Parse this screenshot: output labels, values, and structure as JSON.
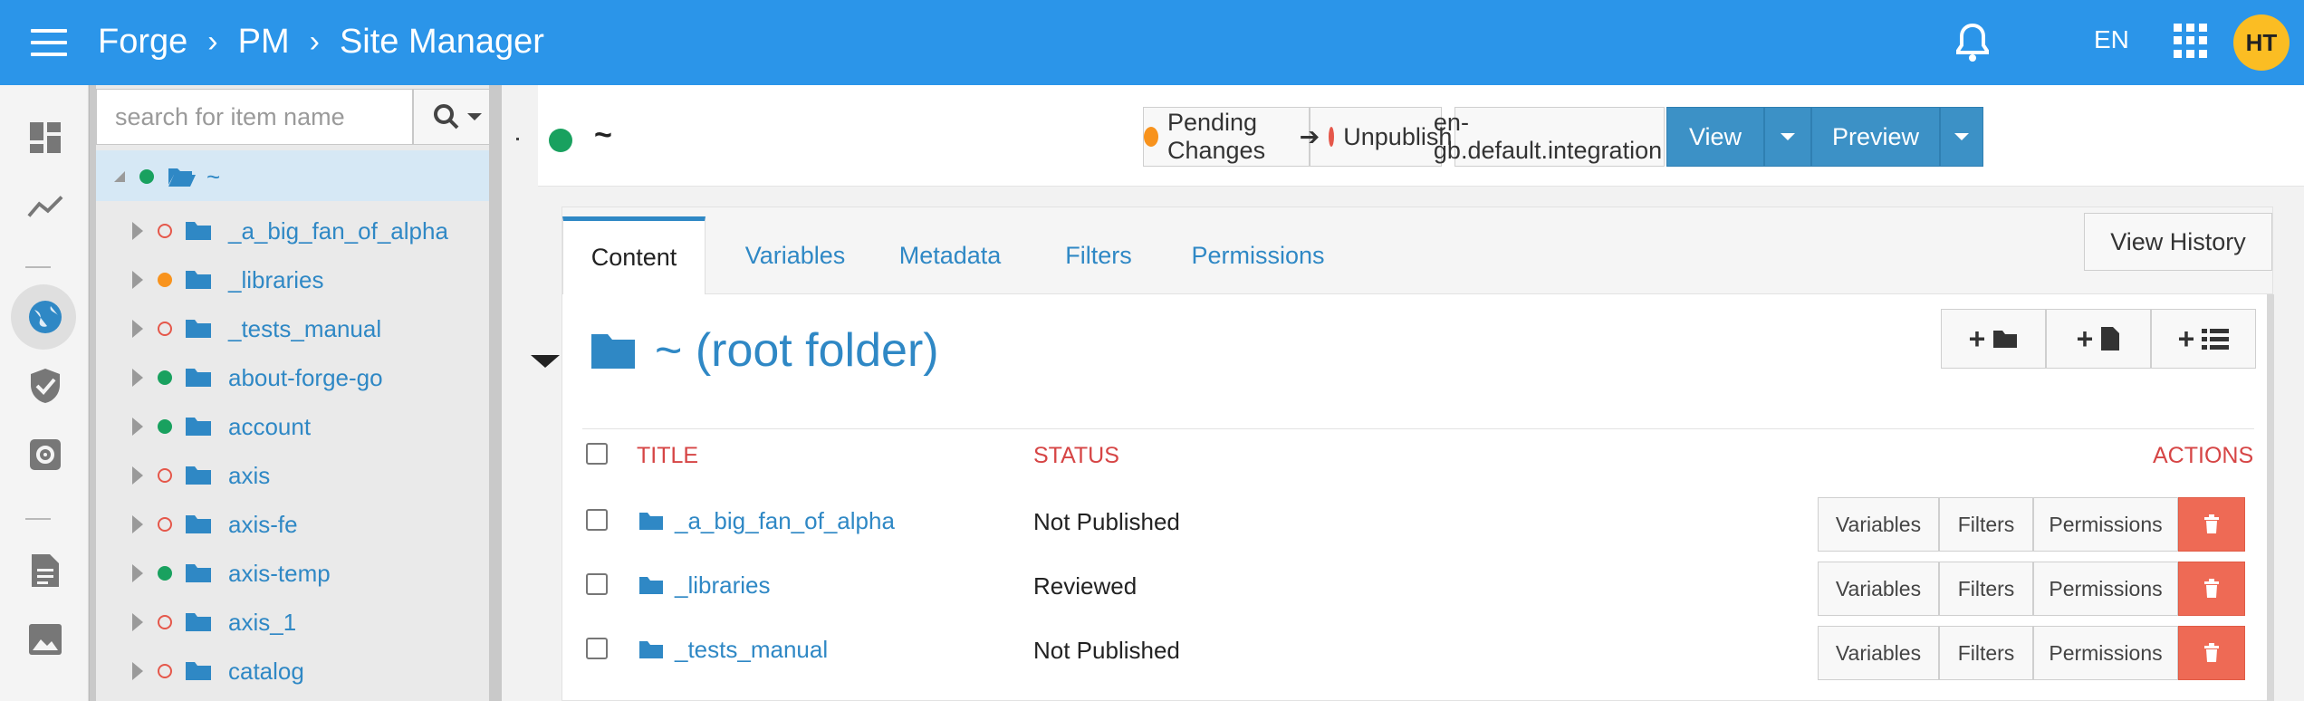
{
  "header": {
    "crumbs": [
      "Forge",
      "PM",
      "Site Manager"
    ],
    "language": "EN",
    "avatar_initials": "HT",
    "color": "#2b95e9"
  },
  "nav_icons": [
    "dashboard-icon",
    "analytics-icon",
    "globe-icon",
    "shield-check-icon",
    "settings-icon",
    "document-icon",
    "image-icon"
  ],
  "tree": {
    "search_placeholder": "search for item name",
    "root_label": "~",
    "items": [
      {
        "label": "_a_big_fan_of_alpha",
        "status": "red"
      },
      {
        "label": "_libraries",
        "status": "orange"
      },
      {
        "label": "_tests_manual",
        "status": "red"
      },
      {
        "label": "about-forge-go",
        "status": "green"
      },
      {
        "label": "account",
        "status": "green"
      },
      {
        "label": "axis",
        "status": "red"
      },
      {
        "label": "axis-fe",
        "status": "red"
      },
      {
        "label": "axis-temp",
        "status": "green"
      },
      {
        "label": "axis_1",
        "status": "red"
      },
      {
        "label": "catalog",
        "status": "red"
      }
    ]
  },
  "toolbar": {
    "path": "~",
    "pending": "Pending Changes",
    "unpublish": "Unpublish",
    "environment": "en-gb.default.integration",
    "view": "View",
    "preview": "Preview"
  },
  "tabs": [
    "Content",
    "Variables",
    "Metadata",
    "Filters",
    "Permissions"
  ],
  "view_history": "View History",
  "page_heading": "~ (root folder)",
  "table": {
    "headers": {
      "title": "TITLE",
      "status": "STATUS",
      "actions": "ACTIONS"
    },
    "action_labels": [
      "Variables",
      "Filters",
      "Permissions"
    ],
    "rows": [
      {
        "title": "_a_big_fan_of_alpha",
        "status": "Not Published"
      },
      {
        "title": "_libraries",
        "status": "Reviewed"
      },
      {
        "title": "_tests_manual",
        "status": "Not Published"
      }
    ]
  }
}
